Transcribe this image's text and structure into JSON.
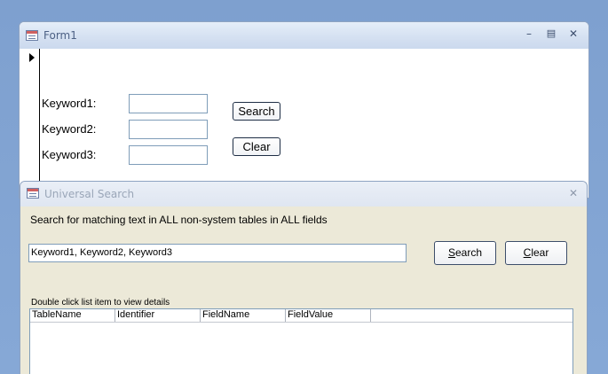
{
  "form1": {
    "title": "Form1",
    "labels": [
      "Keyword1:",
      "Keyword2:",
      "Keyword3:"
    ],
    "values": [
      "",
      "",
      ""
    ],
    "search_label": "Search",
    "clear_label": "Clear"
  },
  "universal_search": {
    "title": "Universal Search",
    "description": "Search for matching text in ALL non-system tables in ALL fields",
    "search_text": "Keyword1, Keyword2, Keyword3",
    "search_label": "Search",
    "search_hotkey": "S",
    "clear_label": "Clear",
    "clear_hotkey": "C",
    "list_hint": "Double click list item to view details",
    "columns": [
      "TableName",
      "Identifier",
      "FieldName",
      "FieldValue"
    ]
  }
}
